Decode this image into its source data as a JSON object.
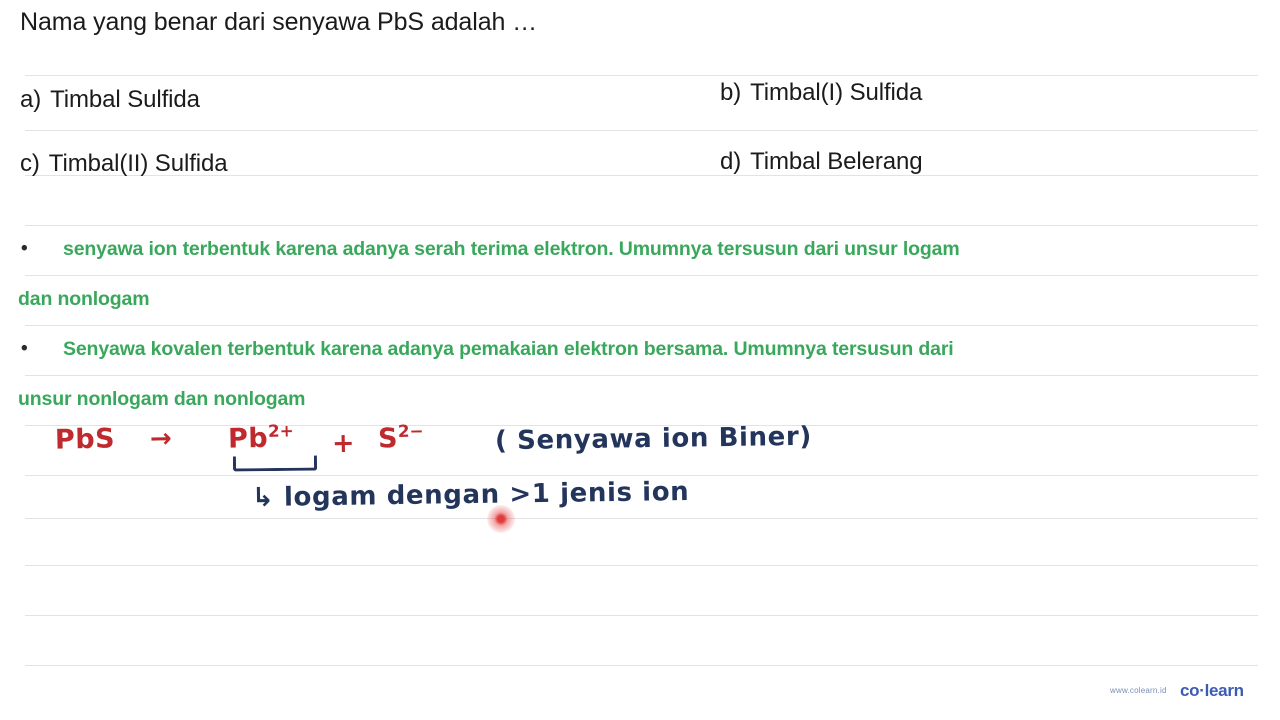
{
  "question": {
    "text": "Nama yang benar dari senyawa PbS adalah …"
  },
  "options": [
    {
      "letter": "a)",
      "label": "Timbal Sulfida"
    },
    {
      "letter": "b)",
      "label": "Timbal(I) Sulfida"
    },
    {
      "letter": "c)",
      "label": "Timbal(II) Sulfida"
    },
    {
      "letter": "d)",
      "label": "Timbal Belerang"
    }
  ],
  "notes": [
    {
      "bullet": "•",
      "line1": "senyawa ion terbentuk karena adanya serah terima elektron. Umumnya tersusun dari unsur logam",
      "line2": "dan nonlogam"
    },
    {
      "bullet": "•",
      "line1": "Senyawa kovalen terbentuk karena adanya pemakaian elektron bersama. Umumnya tersusun dari",
      "line2": "unsur nonlogam dan nonlogam"
    }
  ],
  "annotation": {
    "equation": {
      "reactant": "PbS",
      "arrow": "→",
      "cation": "Pb",
      "cation_charge": "2+",
      "plus": "+",
      "anion": "S",
      "anion_charge": "2−"
    },
    "label_paren": "( Senyawa ion Biner)",
    "sub_note": "↳ logam dengan >1 jenis ion"
  },
  "watermark": {
    "url": "www.colearn.id",
    "logo": "co·learn"
  },
  "colors": {
    "note_green": "#3aa85c",
    "hand_red": "#bf2a2f",
    "hand_blue": "#24355c",
    "rule_line": "#e3e3e5",
    "logo_blue": "#3b5bb5",
    "cursor_red": "#e23b3b"
  },
  "rules": {
    "tops": [
      75,
      130,
      175,
      225,
      275,
      325,
      375,
      425,
      475,
      518,
      565,
      615,
      665
    ]
  }
}
